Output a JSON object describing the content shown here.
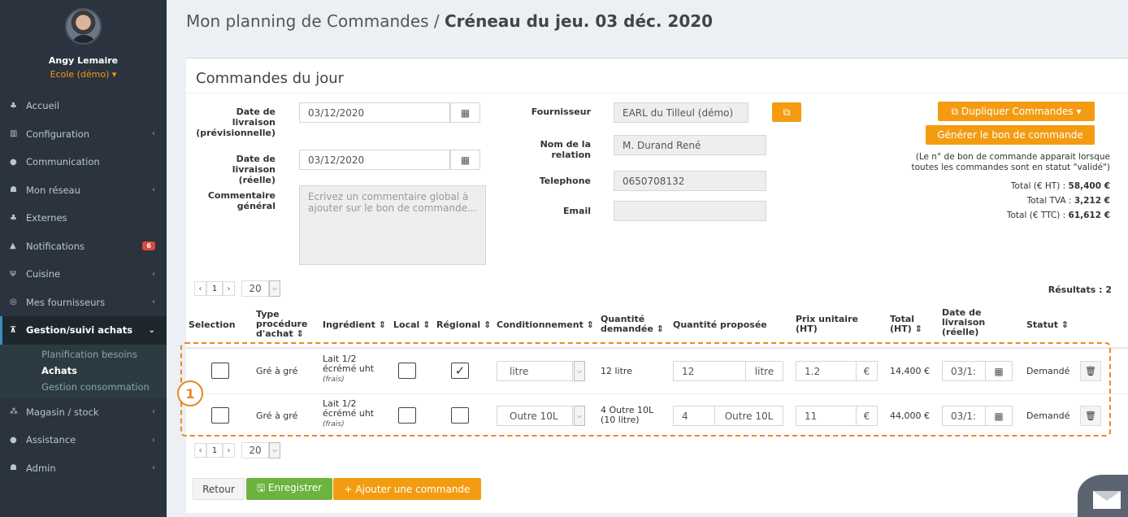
{
  "user": {
    "name": "Angy Lemaire",
    "role": "Ecole (démo) ▾"
  },
  "sidebar": {
    "items": [
      {
        "label": "Accueil",
        "icon": "home-icon",
        "glyph": "♣",
        "chev": ""
      },
      {
        "label": "Configuration",
        "icon": "bank-icon",
        "glyph": "▥",
        "chev": "‹"
      },
      {
        "label": "Communication",
        "icon": "chat-icon",
        "glyph": "●",
        "chev": ""
      },
      {
        "label": "Mon réseau",
        "icon": "users-icon",
        "glyph": "☗",
        "chev": "‹"
      },
      {
        "label": "Externes",
        "icon": "home-icon",
        "glyph": "♣",
        "chev": ""
      },
      {
        "label": "Notifications",
        "icon": "bell-icon",
        "glyph": "▲",
        "badge": "6"
      },
      {
        "label": "Cuisine",
        "icon": "cutlery-icon",
        "glyph": "Ψ",
        "chev": "‹"
      },
      {
        "label": "Mes fournisseurs",
        "icon": "handshake-icon",
        "glyph": "◎",
        "chev": "‹"
      }
    ],
    "active": {
      "label": "Gestion/suivi achats",
      "glyph": "⊼",
      "chev": "⌄"
    },
    "submenu": [
      "Planification besoins",
      "Achats",
      "Gestion consommation"
    ],
    "items_after": [
      {
        "label": "Magasin / stock",
        "icon": "cubes-icon",
        "glyph": "⁂",
        "chev": "‹"
      },
      {
        "label": "Assistance",
        "icon": "info-icon",
        "glyph": "●",
        "chev": "‹"
      },
      {
        "label": "Admin",
        "icon": "user-gear-icon",
        "glyph": "☗",
        "chev": "‹"
      }
    ]
  },
  "header": {
    "title_prefix": "Mon planning de Commandes / ",
    "title_bold": "Créneau du jeu. 03 déc. 2020"
  },
  "box": {
    "title": "Commandes du jour"
  },
  "form": {
    "date_prev_label": "Date de livraison (prévisionnelle)",
    "date_prev_value": "03/12/2020",
    "date_reelle_label": "Date de livraison (réelle)",
    "date_reelle_value": "03/12/2020",
    "comment_label": "Commentaire général",
    "comment_placeholder": "Ecrivez un commentaire global à ajouter sur le bon de commande...",
    "fournisseur_label": "Fournisseur",
    "fournisseur_value": "EARL du Tilleul (démo)",
    "relation_label": "Nom de la relation",
    "relation_value": "M. Durand René",
    "telephone_label": "Telephone",
    "telephone_value": "0650708132",
    "email_label": "Email",
    "email_value": ""
  },
  "actions": {
    "duplicate": "⧉ Dupliquer Commandes ▾",
    "generate": "Générer le bon de commande",
    "note": "(Le n° de bon de commande apparait lorsque toutes les commandes sont en statut \"validé\")",
    "total_ht_label": "Total (€ HT) : ",
    "total_ht": "58,400 €",
    "total_tva_label": "Total TVA : ",
    "total_tva": "3,212 €",
    "total_ttc_label": "Total (€ TTC) : ",
    "total_ttc": "61,612 €"
  },
  "pager": {
    "prev": "‹",
    "page": "1",
    "next": "›",
    "size": "20",
    "results": "Résultats : 2"
  },
  "table": {
    "headers": {
      "selection": "Selection",
      "type": "Type procédure d'achat ⇕",
      "ingredient": "Ingrédient ⇕",
      "local": "Local ⇕",
      "regional": "Régional ⇕",
      "conditionnement": "Conditionnement ⇕",
      "qte_demandee": "Quantité demandée ⇕",
      "qte_proposee": "Quantité proposée",
      "prix": "Prix unitaire (HT)",
      "total": "Total (HT) ⇕",
      "date": "Date de livraison (réelle)",
      "statut": "Statut ⇕"
    },
    "rows": [
      {
        "type": "Gré à gré",
        "ingredient": "Lait 1/2 écrémé uht",
        "ingredient_note": "(frais)",
        "local": "",
        "regional": "✓",
        "conditionnement": "litre",
        "qte_demandee": "12 litre",
        "qte_proposee": "12",
        "unite": "litre",
        "prix": "1.2",
        "devise": "€",
        "total": "14,400 €",
        "date": "03/1:",
        "statut": "Demandé"
      },
      {
        "type": "Gré à gré",
        "ingredient": "Lait 1/2 écrémé uht",
        "ingredient_note": "(frais)",
        "local": "",
        "regional": "",
        "conditionnement": "Outre 10L",
        "qte_demandee": "4 Outre 10L (10 litre)",
        "qte_proposee": "4",
        "unite": "Outre 10L",
        "prix": "11",
        "devise": "€",
        "total": "44,000 €",
        "date": "03/1:",
        "statut": "Demandé"
      }
    ]
  },
  "callout": "1",
  "footer": {
    "back": "Retour",
    "save": "🖫 Enregistrer",
    "add": "+ Ajouter une commande"
  },
  "colors": {
    "sidebar": "#2b333e",
    "accent": "#f39c12",
    "green": "#6cb33f",
    "callout": "#e8891f"
  }
}
